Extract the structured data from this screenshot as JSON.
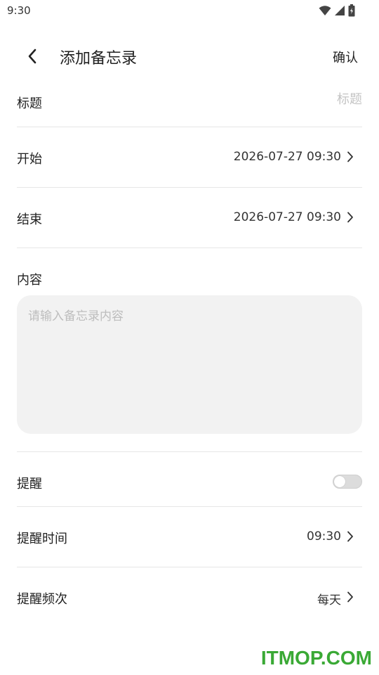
{
  "status_bar": {
    "time": "9:30",
    "icons": [
      "wifi-icon",
      "signal-icon",
      "battery-icon"
    ]
  },
  "header": {
    "title": "添加备忘录",
    "confirm_label": "确认",
    "back_icon": "chevron-left-icon"
  },
  "form": {
    "title_field": {
      "label": "标题",
      "placeholder": "标题",
      "value": ""
    },
    "start": {
      "label": "开始",
      "value": "2026-07-27 09:30"
    },
    "end": {
      "label": "结束",
      "value": "2026-07-27 09:30"
    },
    "content": {
      "label": "内容",
      "placeholder": "请输入备忘录内容",
      "value": ""
    },
    "reminder": {
      "label": "提醒",
      "enabled": false
    },
    "reminder_time": {
      "label": "提醒时间",
      "value": "09:30"
    },
    "reminder_frequency": {
      "label": "提醒频次",
      "value": "每天"
    }
  },
  "watermark": {
    "text": "ITMOP.COM",
    "color": "#3aa935"
  },
  "colors": {
    "divider": "#e6e6e6",
    "content_bg": "#f2f2f2",
    "toggle_off": "#dcdcdc"
  }
}
